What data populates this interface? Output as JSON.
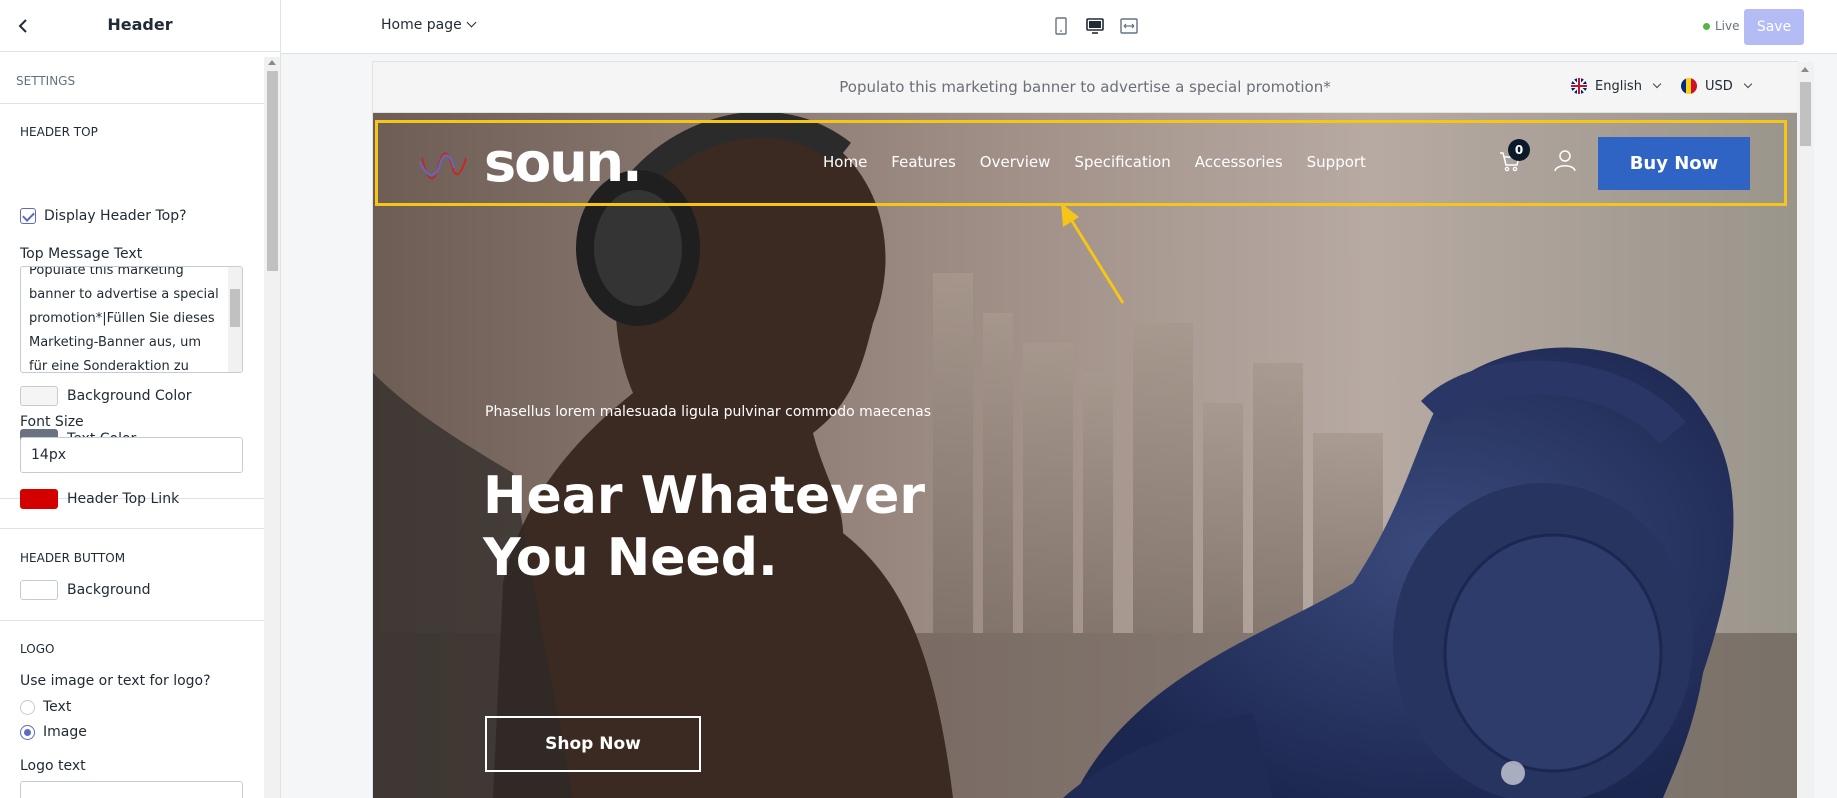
{
  "panel": {
    "title": "Header",
    "settings_label": "SETTINGS",
    "header_top": {
      "heading": "HEADER TOP",
      "display_checkbox_label": "Display Header Top?",
      "top_message_label": "Top Message Text",
      "top_message_value": "Populate this marketing banner to advertise a special promotion*|Füllen Sie dieses Marketing-Banner aus, um für eine Sonderaktion zu werben",
      "background_color_label": "Background Color",
      "background_color": "#f5f5f5",
      "text_color_label": "Text Color",
      "text_color": "#6b7380",
      "font_size_label": "Font Size",
      "font_size_value": "14px",
      "header_top_link_label": "Header Top Link",
      "header_top_link_color": "#d40000"
    },
    "header_bottom": {
      "heading": "HEADER BUTTOM",
      "background_label": "Background",
      "background_color": "#ffffff"
    },
    "logo": {
      "heading": "LOGO",
      "question": "Use image or text for logo?",
      "option_text": "Text",
      "option_image": "Image",
      "selected": "Image",
      "logo_text_label": "Logo text",
      "logo_text_value": ""
    }
  },
  "topbar": {
    "page_select": "Home page",
    "live_label": "Live",
    "save_label": "Save"
  },
  "preview": {
    "banner_message": "Populato this marketing banner to advertise a special promotion*",
    "language": "English",
    "currency": "USD",
    "logo_text": "soun.",
    "menu": [
      "Home",
      "Features",
      "Overview",
      "Specification",
      "Accessories",
      "Support"
    ],
    "cart_count": "0",
    "buy_button": "Buy Now",
    "hero_subtitle": "Phasellus lorem malesuada ligula pulvinar commodo maecenas",
    "hero_title_line1": "Hear Whatever",
    "hero_title_line2": "You Need.",
    "shop_button": "Shop Now"
  },
  "colors": {
    "accent": "#5c6ac4",
    "buy_button": "#2f64c4",
    "highlight": "#f5c518"
  }
}
